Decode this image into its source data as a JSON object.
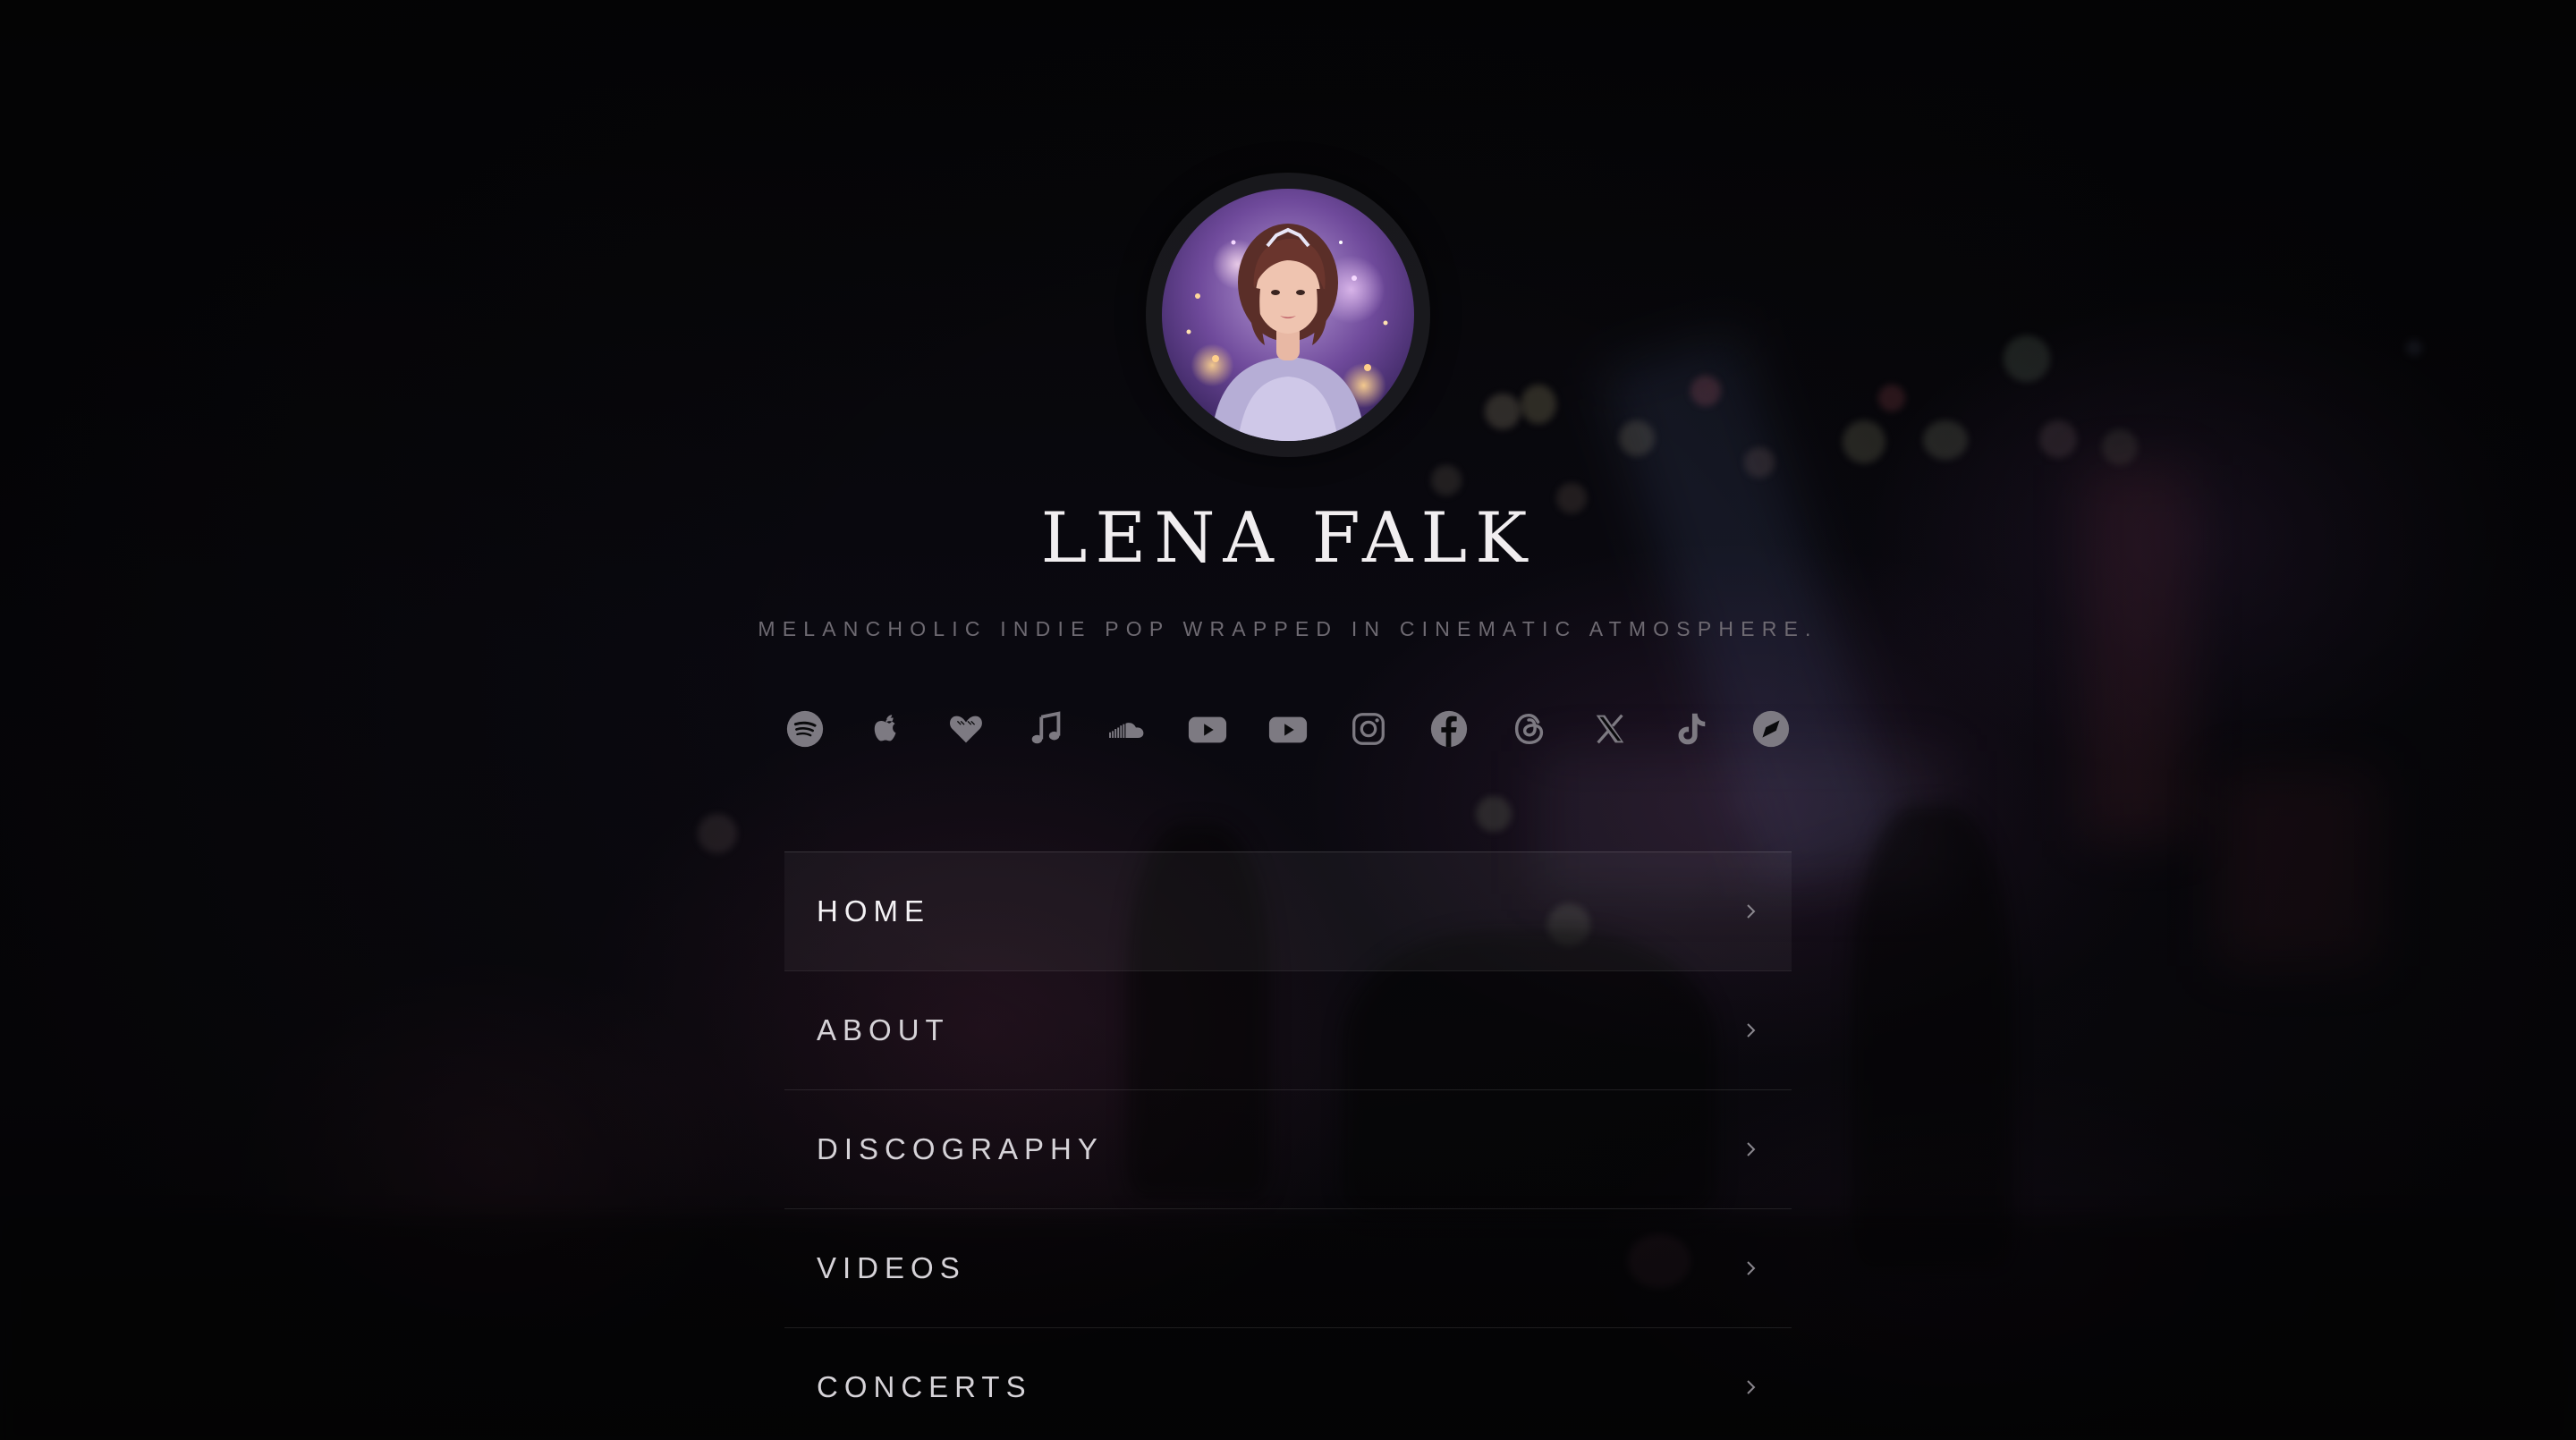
{
  "profile": {
    "name": "LENA FALK",
    "tagline": "MELANCHOLIC INDIE POP WRAPPED IN CINEMATIC ATMOSPHERE."
  },
  "socials": [
    {
      "icon": "spotify-icon"
    },
    {
      "icon": "apple-icon"
    },
    {
      "icon": "heart-icon"
    },
    {
      "icon": "music-note-icon"
    },
    {
      "icon": "soundcloud-icon"
    },
    {
      "icon": "youtube-icon"
    },
    {
      "icon": "youtube-music-icon"
    },
    {
      "icon": "instagram-icon"
    },
    {
      "icon": "facebook-icon"
    },
    {
      "icon": "threads-icon"
    },
    {
      "icon": "x-icon"
    },
    {
      "icon": "tiktok-icon"
    },
    {
      "icon": "bandsintown-icon"
    }
  ],
  "nav": {
    "items": [
      {
        "label": "HOME",
        "active": true
      },
      {
        "label": "ABOUT"
      },
      {
        "label": "DISCOGRAPHY"
      },
      {
        "label": "VIDEOS"
      },
      {
        "label": "CONCERTS"
      }
    ]
  },
  "colors": {
    "background": "#060607",
    "text": "#f1eef0",
    "muted": "#6e6a72",
    "icon": "#7d7a82"
  }
}
